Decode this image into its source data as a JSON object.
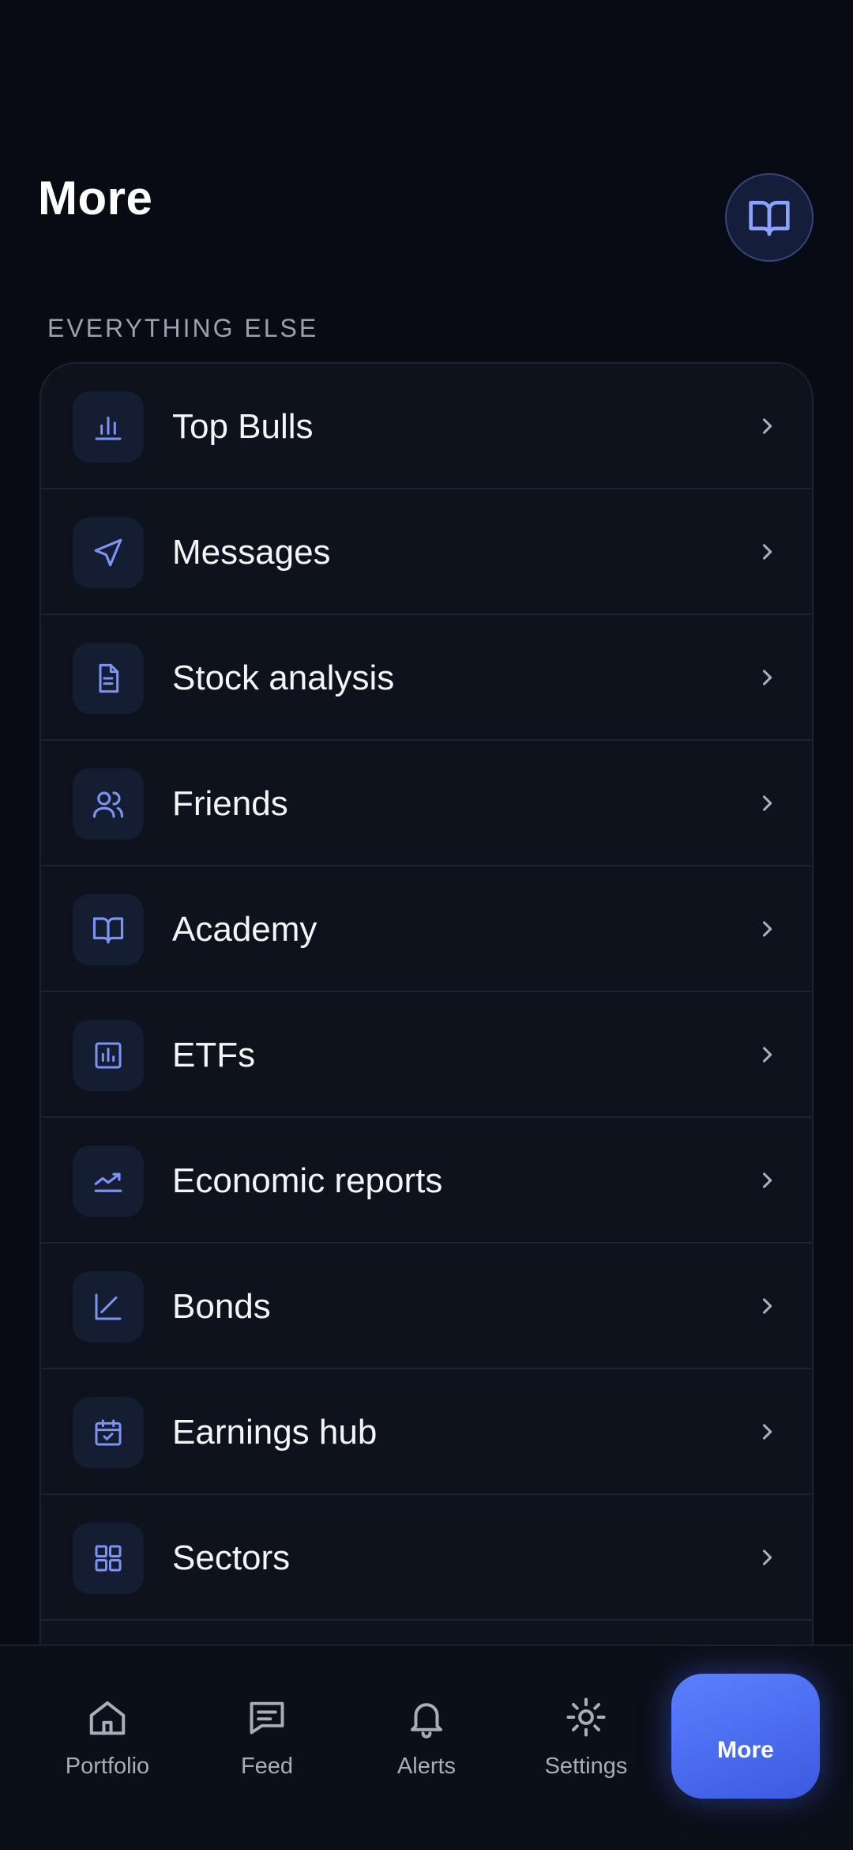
{
  "header": {
    "title": "More"
  },
  "section": {
    "label": "EVERYTHING ELSE"
  },
  "menu": {
    "items": [
      {
        "label": "Top Bulls",
        "icon": "bar-chart-icon"
      },
      {
        "label": "Messages",
        "icon": "send-icon"
      },
      {
        "label": "Stock analysis",
        "icon": "document-icon"
      },
      {
        "label": "Friends",
        "icon": "users-icon"
      },
      {
        "label": "Academy",
        "icon": "book-icon"
      },
      {
        "label": "ETFs",
        "icon": "chart-box-icon"
      },
      {
        "label": "Economic reports",
        "icon": "trend-line-icon"
      },
      {
        "label": "Bonds",
        "icon": "line-chart-icon"
      },
      {
        "label": "Earnings hub",
        "icon": "calendar-check-icon"
      },
      {
        "label": "Sectors",
        "icon": "grid-icon"
      }
    ]
  },
  "tabs": [
    {
      "label": "Portfolio",
      "icon": "home-icon"
    },
    {
      "label": "Feed",
      "icon": "message-icon"
    },
    {
      "label": "Alerts",
      "icon": "bell-icon"
    },
    {
      "label": "Settings",
      "icon": "sun-icon"
    },
    {
      "label": "More",
      "active": true
    }
  ],
  "colors": {
    "background": "#080b13",
    "card": "#0e121c",
    "accent": "#6f8cff",
    "active_tab": "#4c6cf2"
  }
}
